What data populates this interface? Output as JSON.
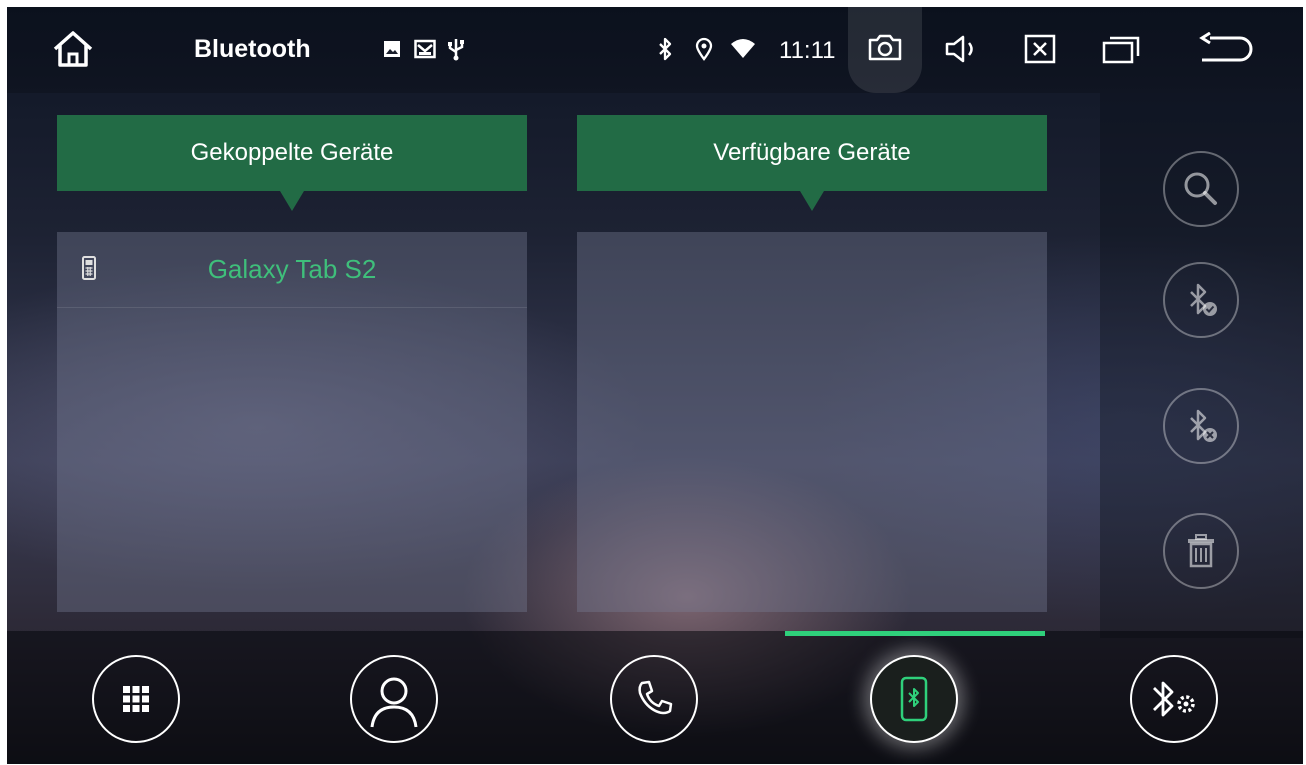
{
  "status_bar": {
    "title": "Bluetooth",
    "time": "11:11",
    "icons": [
      "home-icon",
      "image-icon",
      "mail-icon",
      "usb-icon",
      "bluetooth-icon",
      "location-icon",
      "wifi-icon",
      "camera-icon",
      "volume-icon",
      "close-box-icon",
      "recent-apps-icon",
      "back-icon"
    ]
  },
  "paired_panel": {
    "header": "Gekoppelte Geräte",
    "devices": [
      {
        "name": "Galaxy Tab S2",
        "icon": "phone-icon"
      }
    ]
  },
  "available_panel": {
    "header": "Verfügbare Geräte",
    "devices": []
  },
  "sidebar_actions": [
    "search-icon",
    "bluetooth-connect-icon",
    "bluetooth-disconnect-icon",
    "trash-icon"
  ],
  "bottom_nav": {
    "items": [
      "dialpad-icon",
      "contacts-icon",
      "phone-call-icon",
      "bluetooth-device-icon",
      "bluetooth-settings-icon"
    ],
    "active_index": 3
  },
  "colors": {
    "accent": "#2fd07b",
    "header_green": "#226b45",
    "device_name": "#3fbf7b"
  }
}
